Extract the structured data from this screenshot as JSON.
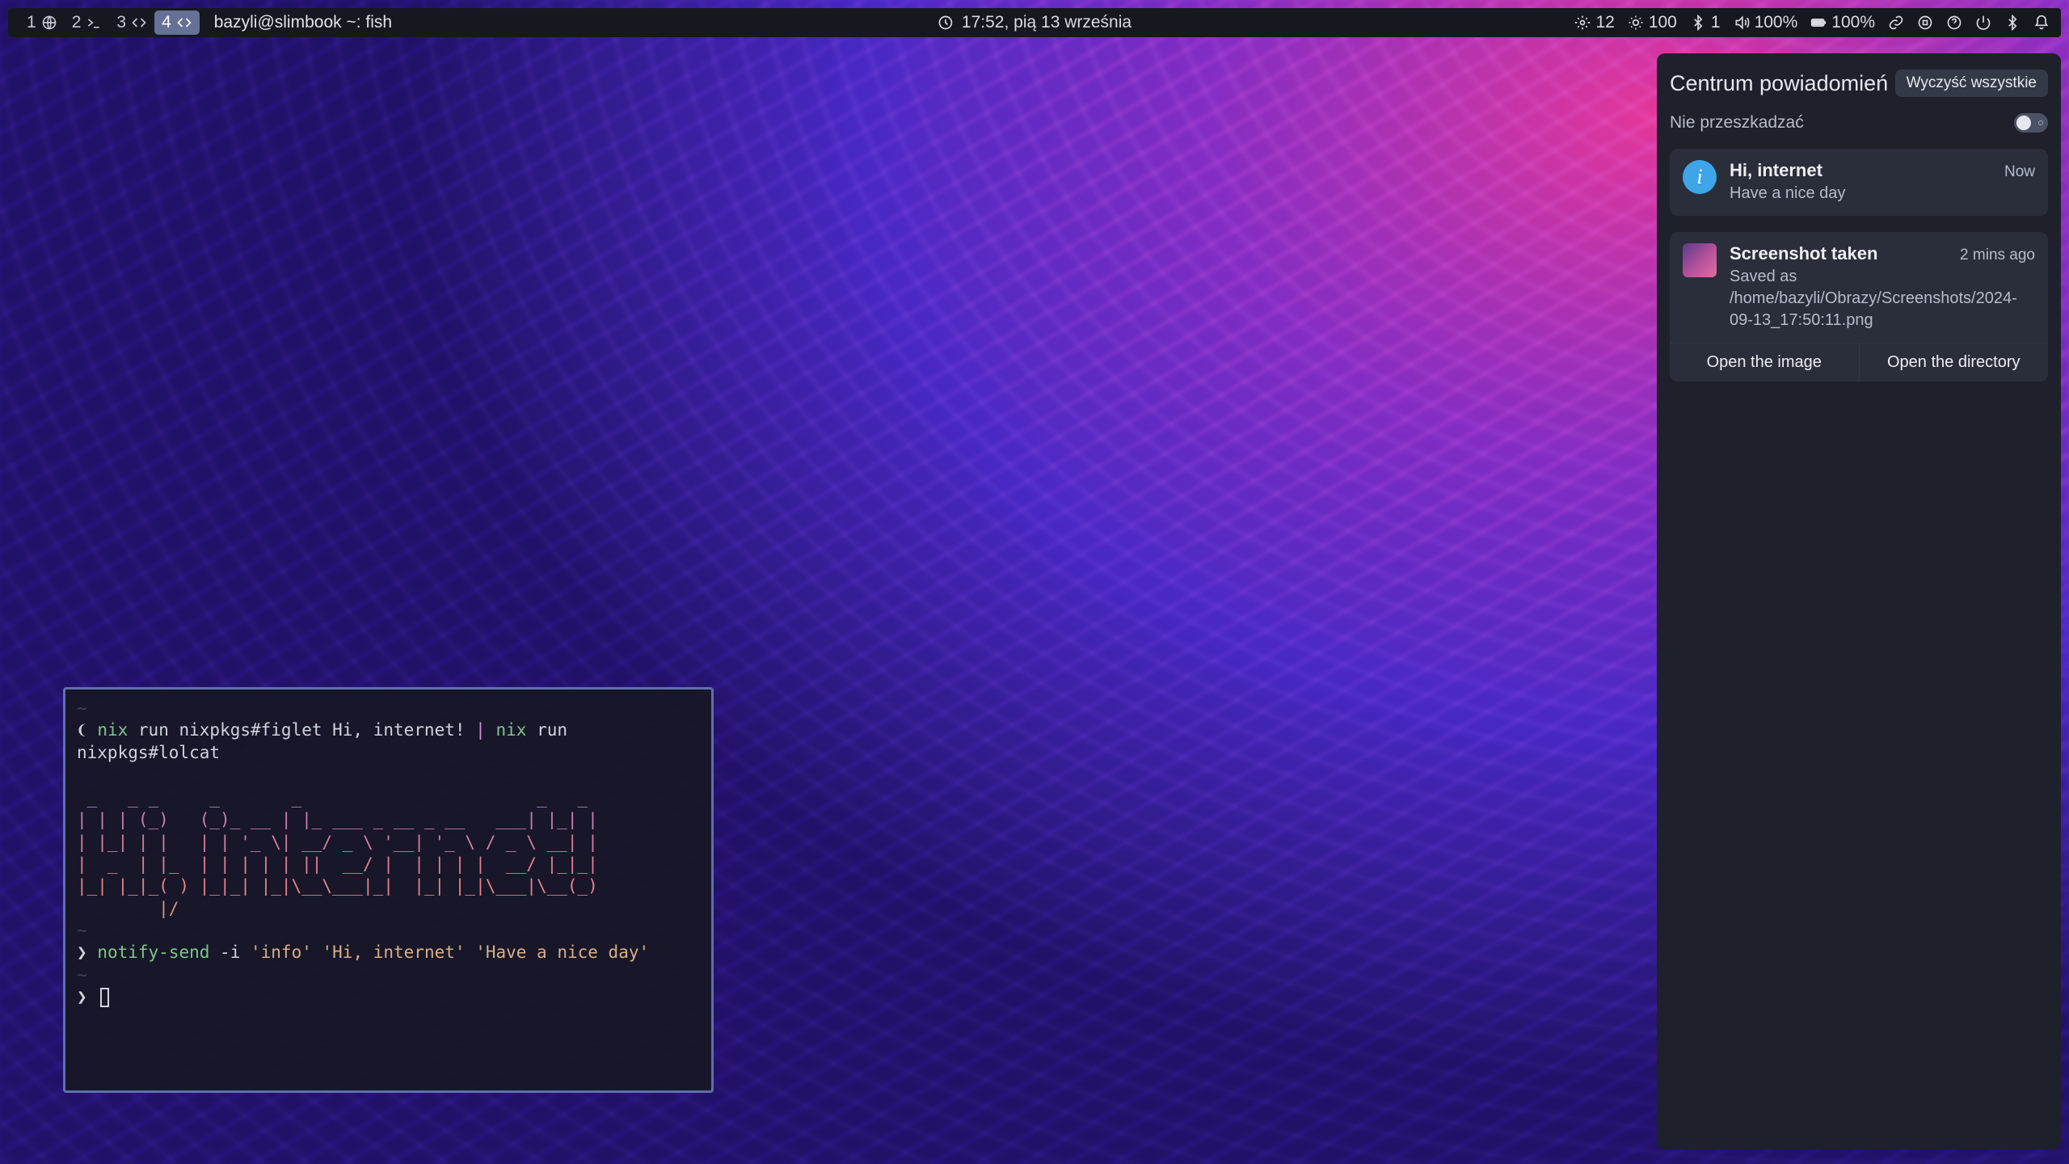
{
  "topbar": {
    "workspaces": [
      {
        "num": "1",
        "icon": "globe",
        "active": false
      },
      {
        "num": "2",
        "icon": "terminal",
        "active": false
      },
      {
        "num": "3",
        "icon": "code",
        "active": false
      },
      {
        "num": "4",
        "icon": "code",
        "active": true
      }
    ],
    "window_title": "bazyli@slimbook ~: fish",
    "clock": "17:52, pią 13 września",
    "tray": {
      "misc_num": "12",
      "brightness": "100",
      "bluetooth": "1",
      "volume": "100%",
      "battery": "100%"
    }
  },
  "terminal": {
    "line1": {
      "prompt": "❨",
      "nix1": "nix",
      "run1": "run",
      "arg1": "nixpkgs#figlet Hi, internet!",
      "pipe": "|",
      "nix2": "nix",
      "run2": "run",
      "arg2": "nixpkgs#lolcat"
    },
    "ascii": [
      " _   _ _     _       _                       _   _ ",
      "| | | (_)   (_)_ __ | |_ ___ _ __ _ __   ___| |_| |",
      "| |_| | |   | | '_ \\| __/ _ \\ '__| '_ \\ / _ \\ __| |",
      "|  _  | |_  | | | | | ||  __/ |  | | | |  __/ |_|_|",
      "|_| |_|_( ) |_|_| |_|\\__\\___|_|  |_| |_|\\___|\\__(_)",
      "        |/                                         "
    ],
    "line2": {
      "prompt": "❯",
      "cmd": "notify-send",
      "flag": "-i",
      "arg_icon": "'info'",
      "arg_title": "'Hi, internet'",
      "arg_body": "'Have a nice day'"
    },
    "line3_prompt": "❯"
  },
  "notif": {
    "title": "Centrum powiadomień",
    "clear": "Wyczyść wszystkie",
    "dnd_label": "Nie przeszkadzać",
    "cards": [
      {
        "icon": "info",
        "title": "Hi, internet",
        "time": "Now",
        "subtitle": "Have a nice day",
        "actions": []
      },
      {
        "icon": "thumb",
        "title": "Screenshot taken",
        "time": "2 mins ago",
        "subtitle": "Saved as /home/bazyli/Obrazy/Screenshots/2024-09-13_17:50:11.png",
        "actions": [
          "Open the image",
          "Open the directory"
        ]
      }
    ]
  }
}
